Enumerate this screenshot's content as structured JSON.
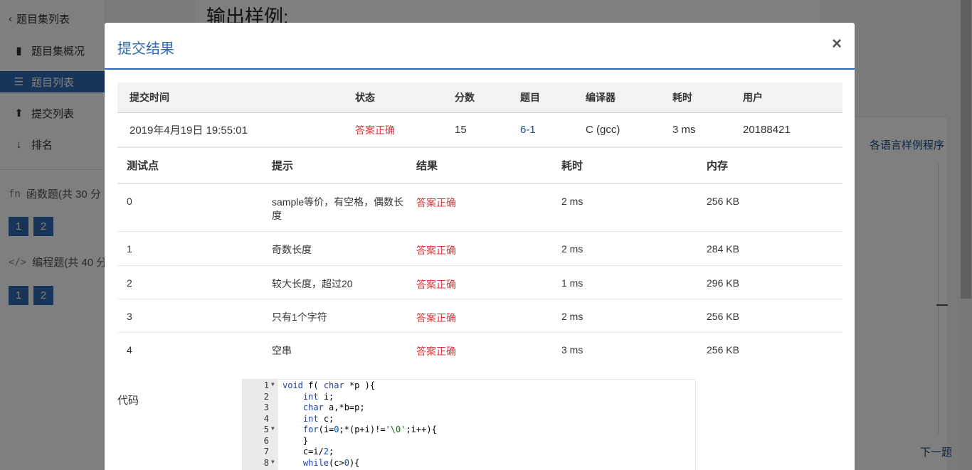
{
  "sidebar": {
    "back_label": "题目集列表",
    "items": [
      {
        "label": "题目集概况",
        "icon": "book-icon"
      },
      {
        "label": "题目列表",
        "icon": "list-icon"
      },
      {
        "label": "提交列表",
        "icon": "upload-icon"
      },
      {
        "label": "排名",
        "icon": "sort-numeric-icon"
      }
    ],
    "sections": [
      {
        "title": "函数题(共 30 分",
        "icon_text": "fn",
        "pages": [
          "1",
          "2"
        ]
      },
      {
        "title": "编程题(共 40 分",
        "icon_text": "</>",
        "pages": [
          "1",
          "2"
        ]
      }
    ]
  },
  "background": {
    "heading": "输出样例:",
    "sample_link": "各语言样例程序",
    "next_link": "下一题"
  },
  "modal": {
    "title": "提交结果",
    "close": "×",
    "submission": {
      "headers": [
        "提交时间",
        "状态",
        "分数",
        "题目",
        "编译器",
        "耗时",
        "用户"
      ],
      "row": {
        "time": "2019年4月19日 19:55:01",
        "status": "答案正确",
        "score": "15",
        "problem": "6-1",
        "compiler": "C (gcc)",
        "elapsed": "3 ms",
        "user": "20188421"
      }
    },
    "cases": {
      "headers": [
        "测试点",
        "提示",
        "结果",
        "耗时",
        "内存"
      ],
      "rows": [
        {
          "id": "0",
          "hint": "sample等价，有空格，偶数长度",
          "result": "答案正确",
          "time": "2 ms",
          "mem": "256 KB"
        },
        {
          "id": "1",
          "hint": "奇数长度",
          "result": "答案正确",
          "time": "2 ms",
          "mem": "284 KB"
        },
        {
          "id": "2",
          "hint": "较大长度，超过20",
          "result": "答案正确",
          "time": "1 ms",
          "mem": "296 KB"
        },
        {
          "id": "3",
          "hint": "只有1个字符",
          "result": "答案正确",
          "time": "2 ms",
          "mem": "256 KB"
        },
        {
          "id": "4",
          "hint": "空串",
          "result": "答案正确",
          "time": "3 ms",
          "mem": "256 KB"
        }
      ]
    },
    "code_label": "代码",
    "code_lines": [
      {
        "n": "1",
        "fold": true,
        "text": "void f( char *p ){"
      },
      {
        "n": "2",
        "fold": false,
        "text": "    int i;"
      },
      {
        "n": "3",
        "fold": false,
        "text": "    char a,*b=p;"
      },
      {
        "n": "4",
        "fold": false,
        "text": "    int c;"
      },
      {
        "n": "5",
        "fold": true,
        "text": "    for(i=0;*(p+i)!='\\0';i++){"
      },
      {
        "n": "6",
        "fold": false,
        "text": "    }"
      },
      {
        "n": "7",
        "fold": false,
        "text": "    c=i/2;"
      },
      {
        "n": "8",
        "fold": true,
        "text": "    while(c>0){"
      }
    ]
  },
  "colors": {
    "accent": "#2e6ab3",
    "success": "#d9383a",
    "link": "#1f4e88"
  }
}
